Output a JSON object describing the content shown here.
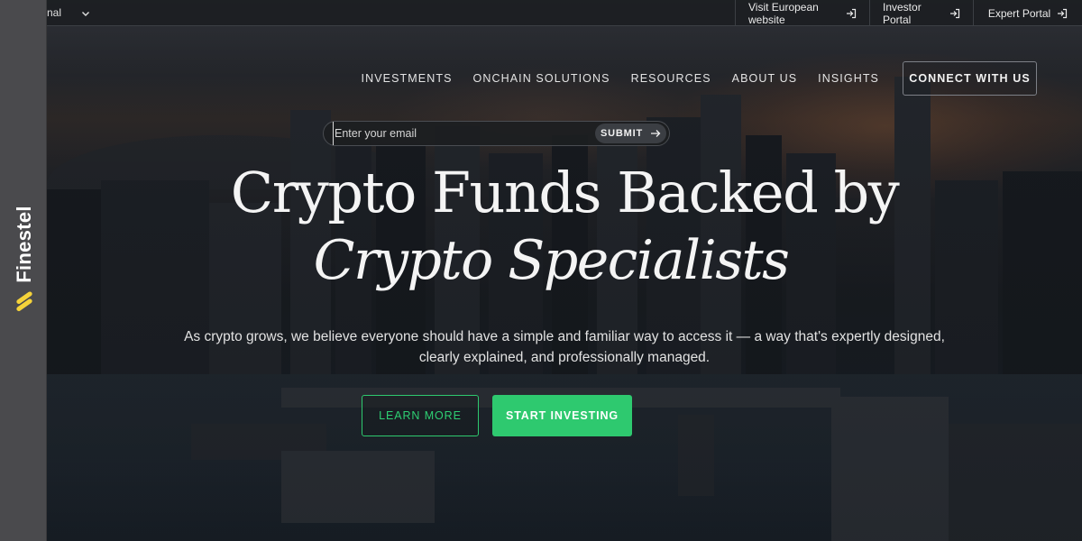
{
  "brand": {
    "name": "Finestel",
    "logo_icon": "finestel-logo-icon"
  },
  "topbar": {
    "region_label": "nal",
    "links": [
      {
        "label": "Visit European website",
        "icon": "external-link-icon"
      },
      {
        "label": "Investor Portal",
        "icon": "external-link-icon"
      },
      {
        "label": "Expert Portal",
        "icon": "external-link-icon"
      }
    ]
  },
  "nav": {
    "items": [
      "INVESTMENTS",
      "ONCHAIN SOLUTIONS",
      "RESOURCES",
      "ABOUT US",
      "INSIGHTS"
    ],
    "cta": "CONNECT WITH US"
  },
  "email_form": {
    "placeholder": "Enter your email",
    "value": "",
    "submit_label": "SUBMIT"
  },
  "hero": {
    "title_line1": "Crypto Funds Backed by",
    "title_line2": "Crypto Specialists",
    "subtitle_line1": "As crypto grows, we believe everyone should have a simple and familiar way to access it — a way that's expertly designed,",
    "subtitle_line2": "clearly explained, and professionally managed.",
    "learn_more_label": "LEARN MORE",
    "start_investing_label": "START INVESTING"
  },
  "colors": {
    "accent_green": "#2ec96f",
    "brand_yellow": "#f5d33a",
    "brandbar_bg": "#4a4a4d",
    "topbar_bg": "#1c1e22"
  }
}
